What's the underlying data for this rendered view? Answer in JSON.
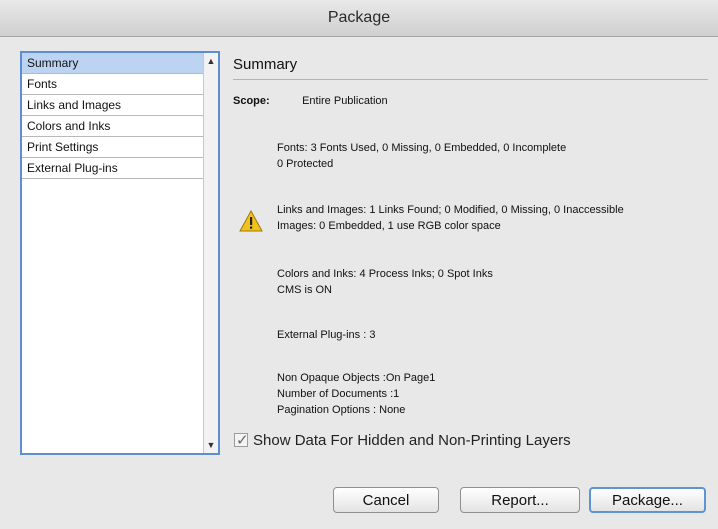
{
  "window": {
    "title": "Package"
  },
  "sidebar": {
    "items": [
      {
        "label": "Summary",
        "selected": true
      },
      {
        "label": "Fonts"
      },
      {
        "label": "Links and Images"
      },
      {
        "label": "Colors and Inks"
      },
      {
        "label": "Print Settings"
      },
      {
        "label": "External Plug-ins"
      }
    ]
  },
  "summary": {
    "title": "Summary",
    "scope_label": "Scope:",
    "scope_value": "Entire Publication",
    "fonts": {
      "line1": "Fonts: 3 Fonts Used, 0 Missing, 0 Embedded, 0 Incomplete",
      "line2": "0 Protected"
    },
    "links": {
      "warning_icon": "warning-triangle-icon",
      "line1": "Links and Images: 1 Links Found; 0 Modified, 0 Missing, 0 Inaccessible",
      "line2": "Images: 0 Embedded, 1 use RGB color space"
    },
    "colors": {
      "line1": "Colors and Inks: 4 Process Inks; 0 Spot Inks",
      "line2": "CMS is ON"
    },
    "plugins": {
      "line1": "External Plug-ins : 3"
    },
    "misc": {
      "line1": "Non Opaque Objects :On Page1",
      "line2": "Number of Documents :1",
      "line3": "Pagination Options : None"
    }
  },
  "options": {
    "show_hidden_label": "Show Data For Hidden and Non-Printing Layers",
    "show_hidden_checked": true
  },
  "buttons": {
    "cancel": "Cancel",
    "report": "Report...",
    "package": "Package..."
  },
  "colors": {
    "selection": "#bcd3f1",
    "focus_ring": "#5b8fd2",
    "warning": "#f2c21b"
  }
}
